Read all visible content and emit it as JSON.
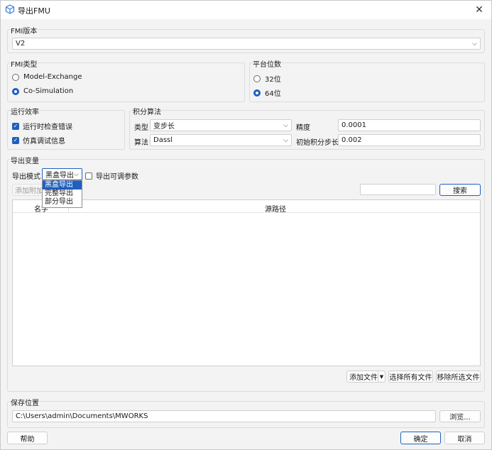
{
  "window": {
    "title": "导出FMU",
    "close_glyph": "✕"
  },
  "fmi_version": {
    "title": "FMI版本",
    "value": "V2"
  },
  "fmi_type": {
    "title": "FMI类型",
    "options": [
      "Model-Exchange",
      "Co-Simulation"
    ],
    "selected": "Co-Simulation"
  },
  "platform": {
    "title": "平台位数",
    "options": [
      "32位",
      "64位"
    ],
    "selected": "64位"
  },
  "runtime": {
    "title": "运行效率",
    "checks": [
      {
        "label": "运行时检查错误",
        "checked": true
      },
      {
        "label": "仿真调试信息",
        "checked": true
      }
    ]
  },
  "integration": {
    "title": "积分算法",
    "type_label": "类型",
    "type_value": "变步长",
    "precision_label": "精度",
    "precision_value": "0.0001",
    "algorithm_label": "算法",
    "algorithm_value": "Dassl",
    "initial_step_label": "初始积分步长",
    "initial_step_value": "0.002"
  },
  "export_vars": {
    "title": "导出变量",
    "mode_label": "导出模式",
    "mode_value": "黑盒导出",
    "tunable_label": "导出可调参数",
    "add_extra_label": "添加附加",
    "search_button": "搜索",
    "search_value": "",
    "mode_options": [
      "黑盒导出",
      "完整导出",
      "部分导出"
    ],
    "table_columns": [
      "名字",
      "源路径"
    ],
    "rows": []
  },
  "file_buttons": {
    "add_file": "添加文件",
    "select_all": "选择所有文件",
    "remove_selected": "移除所选文件"
  },
  "save": {
    "title": "保存位置",
    "path": "C:\\Users\\admin\\Documents\\MWORKS",
    "browse": "浏览..."
  },
  "footer": {
    "help": "帮助",
    "ok": "确定",
    "cancel": "取消"
  },
  "colors": {
    "accent": "#1f5fbf",
    "window_bg": "#f3f3f3"
  },
  "icons": [
    "cube-icon",
    "close-icon",
    "chevron-down-icon",
    "check-icon"
  ]
}
